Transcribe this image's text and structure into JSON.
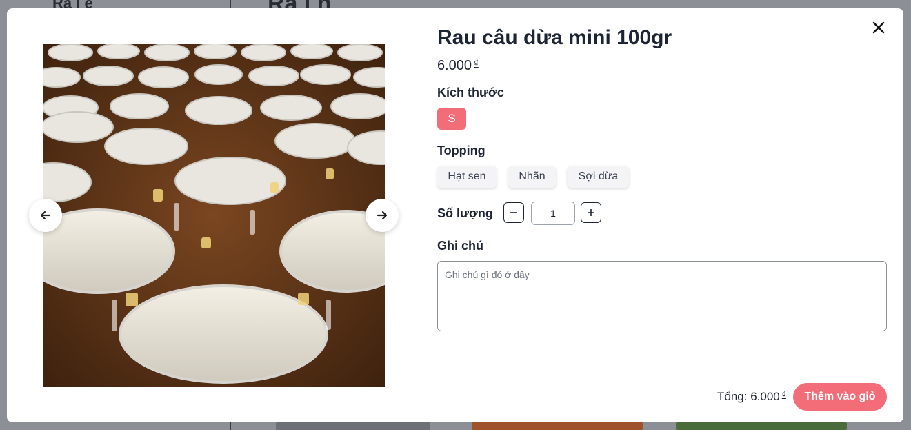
{
  "background": {
    "left_heading": "Ra i        ể",
    "main_heading": "Ra    i h"
  },
  "product": {
    "name": "Rau câu dừa mini 100gr",
    "price": "6.000",
    "currency": "₫"
  },
  "size": {
    "label": "Kích thước",
    "options": [
      "S"
    ],
    "selected": "S"
  },
  "topping": {
    "label": "Topping",
    "options": [
      "Hạt sen",
      "Nhãn",
      "Sợi dừa"
    ]
  },
  "quantity": {
    "label": "Số lượng",
    "value": "1"
  },
  "note": {
    "label": "Ghi chú",
    "placeholder": "Ghi chú gì đó ở đây"
  },
  "footer": {
    "total_label": "Tổng: 6.000",
    "currency": "₫",
    "add_button": "Thêm vào giỏ"
  },
  "colors": {
    "accent": "#f26d78",
    "text": "#1d2433",
    "overlay": "#8c8f96"
  },
  "icons": {
    "close": "close-icon",
    "prev": "arrow-left-icon",
    "next": "arrow-right-icon",
    "minus": "minus-icon",
    "plus": "plus-icon"
  }
}
